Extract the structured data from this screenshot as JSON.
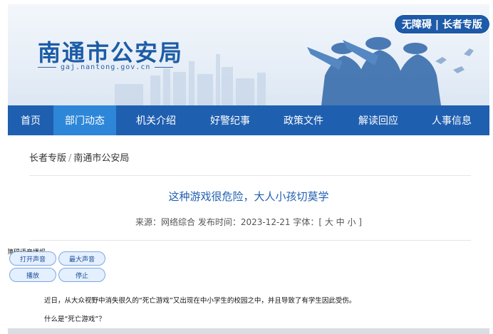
{
  "header": {
    "site_title": "南通市公安局",
    "site_url": "gaj.nantong.gov.cn",
    "accessibility_button": "无障碍 | 长者专版"
  },
  "nav": {
    "items": [
      {
        "label": "首页",
        "active": false
      },
      {
        "label": "部门动态",
        "active": true
      },
      {
        "label": "机关介绍",
        "active": false
      },
      {
        "label": "好警纪事",
        "active": false
      },
      {
        "label": "政策文件",
        "active": false
      },
      {
        "label": "解读回应",
        "active": false
      },
      {
        "label": "人事信息",
        "active": false
      }
    ]
  },
  "breadcrumb": {
    "first": "长者专版",
    "separator": "/",
    "second": "南通市公安局"
  },
  "article": {
    "title": "这种游戏很危险，大人小孩切莫学",
    "meta": "来源：网络综合  发布时间：2023-12-21  字体：[ 大 中 小 ]",
    "paragraphs": [
      "近日，从大众视野中消失很久的“死亡游戏”又出现在中小学生的校园之中，并且导致了有学生因此受伤。",
      "什么是“死亡游戏”？"
    ]
  },
  "tts": {
    "title": "无障碍语音播报",
    "open_sound": "打开声音",
    "max_sound": "最大声音",
    "play": "播放",
    "stop": "停止"
  },
  "colors": {
    "brand_blue": "#1f5fb0",
    "nav_active": "#2d86d8",
    "title_blue": "#1c5ca6"
  }
}
